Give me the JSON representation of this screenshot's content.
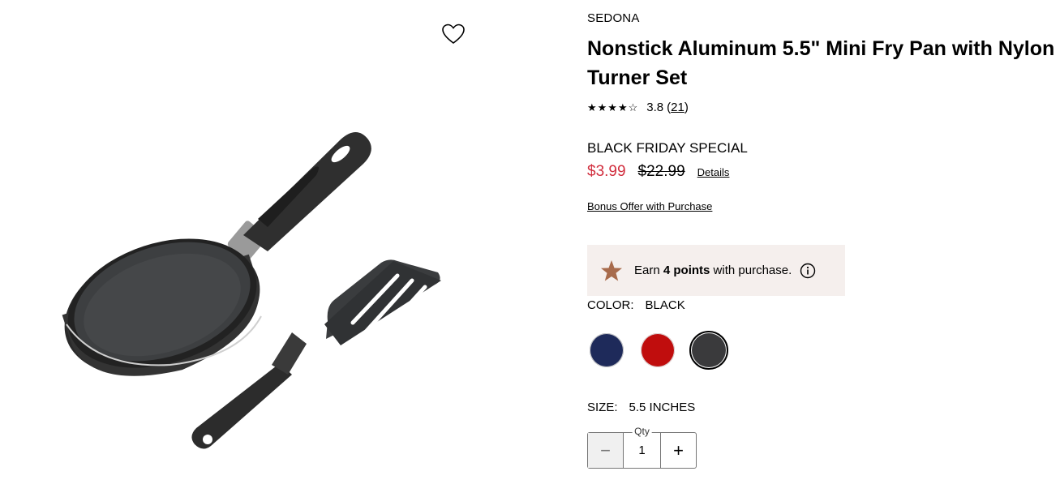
{
  "product": {
    "brand": "SEDONA",
    "title": "Nonstick Aluminum 5.5\" Mini Fry Pan with Nylon Turner Set",
    "rating": {
      "stars": "★★★★☆",
      "value": "3.8",
      "count_open": "(",
      "count": "21",
      "count_close": ")"
    },
    "promo_label": "BLACK FRIDAY SPECIAL",
    "sale_price": "$3.99",
    "original_price": "$22.99",
    "details_label": "Details",
    "bonus_offer_label": "Bonus Offer with Purchase"
  },
  "points": {
    "prefix": "Earn ",
    "amount": "4 points",
    "suffix": " with purchase.",
    "icon": "star-icon",
    "star_color": "#a86b4c",
    "background": "#f5efed"
  },
  "color": {
    "label": "COLOR:",
    "selected": "BLACK",
    "swatches": [
      {
        "name": "navy",
        "hex": "#1e2a5a"
      },
      {
        "name": "red",
        "hex": "#c00d0d"
      },
      {
        "name": "black",
        "hex": "#3a3a3c",
        "selected": true
      }
    ]
  },
  "size": {
    "label": "SIZE:",
    "selected": "5.5 INCHES"
  },
  "quantity": {
    "label": "Qty",
    "value": "1",
    "minus": "−",
    "plus": "+"
  },
  "colors": {
    "sale": "#d12d3d"
  }
}
